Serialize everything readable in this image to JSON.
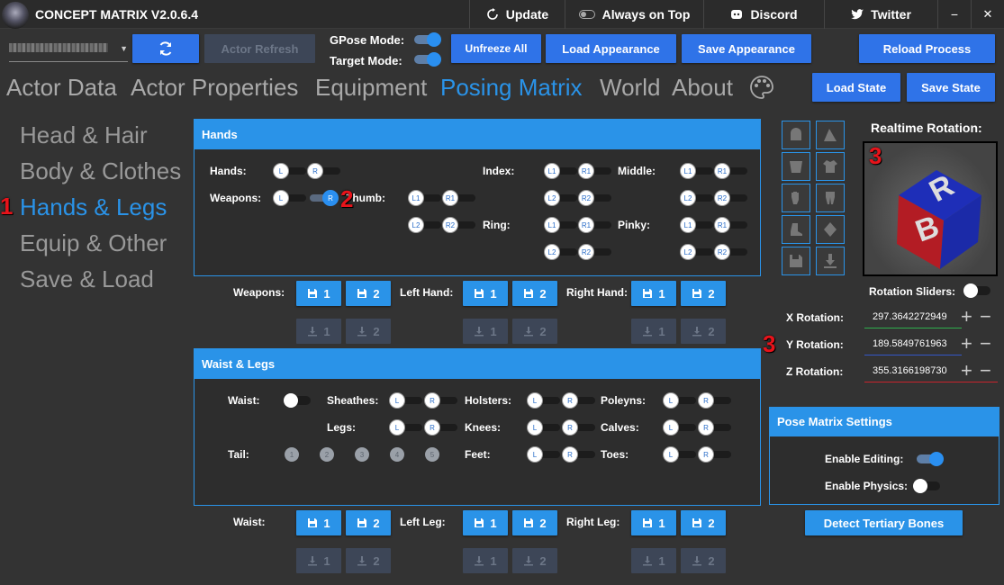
{
  "titlebar": {
    "app_title": "CONCEPT MATRIX V2.0.6.4",
    "update": "Update",
    "always_on_top": "Always on Top",
    "discord": "Discord",
    "twitter": "Twitter",
    "minimize": "−",
    "close": "✕"
  },
  "toolbar": {
    "actor_refresh": "Actor Refresh",
    "gpose_mode": "GPose Mode:",
    "target_mode": "Target Mode:",
    "unfreeze_all": "Unfreeze All",
    "load_appearance": "Load Appearance",
    "save_appearance": "Save Appearance",
    "reload_process": "Reload Process",
    "load_state": "Load State",
    "save_state": "Save State"
  },
  "tabs": [
    "Actor Data",
    "Actor Properties",
    "Equipment",
    "Posing Matrix",
    "World",
    "About"
  ],
  "sidebar": [
    "Head & Hair",
    "Body & Clothes",
    "Hands & Legs",
    "Equip & Other",
    "Save & Load"
  ],
  "markers": {
    "m1": "1",
    "m2": "2",
    "m3a": "3",
    "m3b": "3"
  },
  "hands_panel": {
    "title": "Hands",
    "hands": "Hands:",
    "weapons": "Weapons:",
    "thumb": "Thumb:",
    "index": "Index:",
    "middle": "Middle:",
    "ring": "Ring:",
    "pinky": "Pinky:"
  },
  "pills": {
    "L": "L",
    "R": "R",
    "L1": "L1",
    "R1": "R1",
    "L2": "L2",
    "R2": "R2"
  },
  "save_rows": {
    "weapons": "Weapons:",
    "left_hand": "Left Hand:",
    "right_hand": "Right Hand:",
    "waist": "Waist:",
    "left_leg": "Left Leg:",
    "right_leg": "Right Leg:",
    "one": "1",
    "two": "2"
  },
  "waist_panel": {
    "title": "Waist & Legs",
    "waist": "Waist:",
    "sheathes": "Sheathes:",
    "holsters": "Holsters:",
    "poleyns": "Poleyns:",
    "legs": "Legs:",
    "knees": "Knees:",
    "calves": "Calves:",
    "tail": "Tail:",
    "feet": "Feet:",
    "toes": "Toes:",
    "tail_nums": [
      "1",
      "2",
      "3",
      "4",
      "5"
    ]
  },
  "rotation": {
    "title": "Realtime Rotation:",
    "sliders": "Rotation Sliders:",
    "x_label": "X Rotation:",
    "y_label": "Y Rotation:",
    "z_label": "Z Rotation:",
    "x_value": "297.3642272949",
    "y_value": "189.5849761963",
    "z_value": "355.3166198730",
    "plus": "+",
    "minus": "−",
    "cube_b": "B",
    "cube_r": "R"
  },
  "pose_settings": {
    "title": "Pose Matrix Settings",
    "enable_editing": "Enable Editing:",
    "enable_physics": "Enable Physics:",
    "detect": "Detect Tertiary Bones"
  },
  "colors": {
    "accent": "#2a93e8",
    "button": "#2f73e8",
    "red_marker": "#e8131a"
  }
}
